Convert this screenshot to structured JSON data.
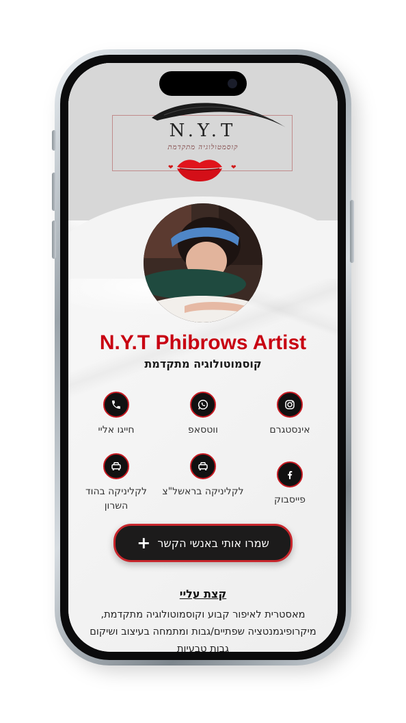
{
  "logo": {
    "title": "N.Y.T",
    "subtitle": "קוסמטולוגיה מתקדמת"
  },
  "profile": {
    "name": "N.Y.T Phibrows Artist",
    "tagline": "קוסמוטולוגיה מתקדמת"
  },
  "actions": [
    {
      "label": "חייגו אליי",
      "icon": "phone-icon"
    },
    {
      "label": "ווטסאפ",
      "icon": "whatsapp-icon"
    },
    {
      "label": "אינסטגרם",
      "icon": "instagram-icon"
    },
    {
      "label": "לקליניקה בהוד השרון",
      "icon": "car-icon"
    },
    {
      "label": "לקליניקה בראשל\"צ",
      "icon": "car-icon"
    },
    {
      "label": "פייסבוק",
      "icon": "facebook-icon"
    }
  ],
  "save_button": {
    "label": "שמרו אותי באנשי הקשר",
    "plus": "+"
  },
  "about": {
    "title": "קצת עליי",
    "text": "מאסטרית לאיפור קבוע וקוסמוטולוגיה מתקדמת, מיקרופיגמנטציה שפתיים/גבות ומתמחה בעיצוב ושיקום גבות טבעיות"
  },
  "colors": {
    "accent": "#c80012",
    "button_bg": "#1c1b1b",
    "button_border": "#c8262c",
    "icon_bg": "#111111"
  }
}
